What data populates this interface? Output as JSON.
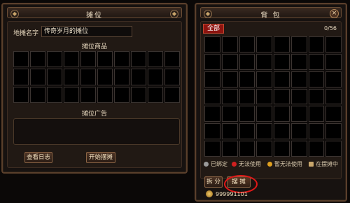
{
  "left_panel": {
    "title": "摊位",
    "stall_name_label": "地摊名字",
    "stall_name_value": "传奇岁月的摊位",
    "goods_heading": "摊位商品",
    "goods_grid": {
      "rows": 3,
      "cols": 10
    },
    "ad_heading": "摊位广告",
    "ad_text": "",
    "view_log_button": "查看日志",
    "start_stall_button": "开始摆摊"
  },
  "right_panel": {
    "title": "背    包",
    "tab_all": "全部",
    "capacity": "0/56",
    "bag_grid": {
      "rows": 7,
      "cols": 8
    },
    "legend": [
      {
        "label": "已绑定",
        "color": "#9a9a9a",
        "icon": "circle-grey-icon"
      },
      {
        "label": "无法使用",
        "color": "#d02020",
        "icon": "circle-red-icon"
      },
      {
        "label": "暂无法使用",
        "color": "#e0a020",
        "icon": "circle-yellow-icon"
      },
      {
        "label": "在摆摊中",
        "color": "#c8a66b",
        "icon": "stall-bag-icon"
      }
    ],
    "split_button": "拆 分",
    "stall_button": "摆 摊",
    "gold": "999991101"
  }
}
